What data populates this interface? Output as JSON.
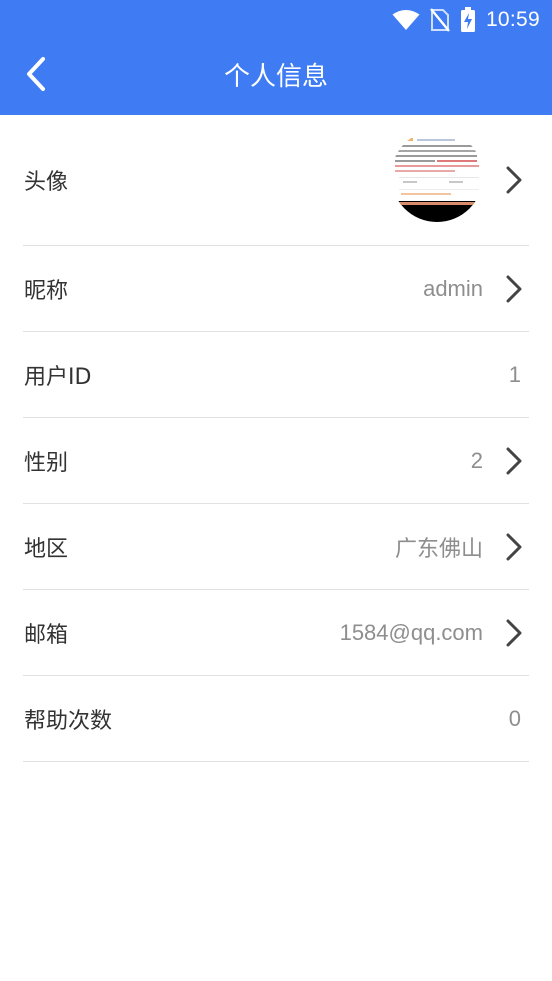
{
  "status_bar": {
    "time": "10:59"
  },
  "nav": {
    "title": "个人信息"
  },
  "rows": {
    "avatar": {
      "label": "头像"
    },
    "nickname": {
      "label": "昵称",
      "value": "admin"
    },
    "user_id": {
      "label": "用户ID",
      "value": "1"
    },
    "gender": {
      "label": "性别",
      "value": "2"
    },
    "region": {
      "label": "地区",
      "value": "广东佛山"
    },
    "email": {
      "label": "邮箱",
      "value": "1584@qq.com"
    },
    "help_count": {
      "label": "帮助次数",
      "value": "0"
    }
  },
  "colors": {
    "header": "#3f7cf4",
    "label": "#333333",
    "value": "#8e8e8e",
    "divider": "#e2e2e2"
  },
  "icons": [
    "wifi-icon",
    "no-sim-icon",
    "battery-charging-icon",
    "back-arrow-icon",
    "chevron-right-icon"
  ]
}
